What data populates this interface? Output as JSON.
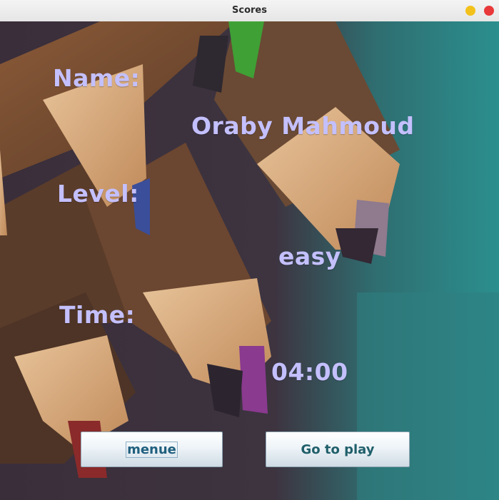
{
  "window": {
    "title": "Scores"
  },
  "labels": {
    "name_label": "Name:",
    "level_label": "Level:",
    "time_label": "Time:"
  },
  "values": {
    "name": "Oraby Mahmoud",
    "level": "easy",
    "time": "04:00"
  },
  "buttons": {
    "menu": "menue",
    "play": "Go to play"
  },
  "icons": {
    "minimize": "minimize-icon",
    "close": "close-icon"
  },
  "colors": {
    "text": "#c4c0ff",
    "minimize": "#f3c11b",
    "close": "#e8383a"
  }
}
